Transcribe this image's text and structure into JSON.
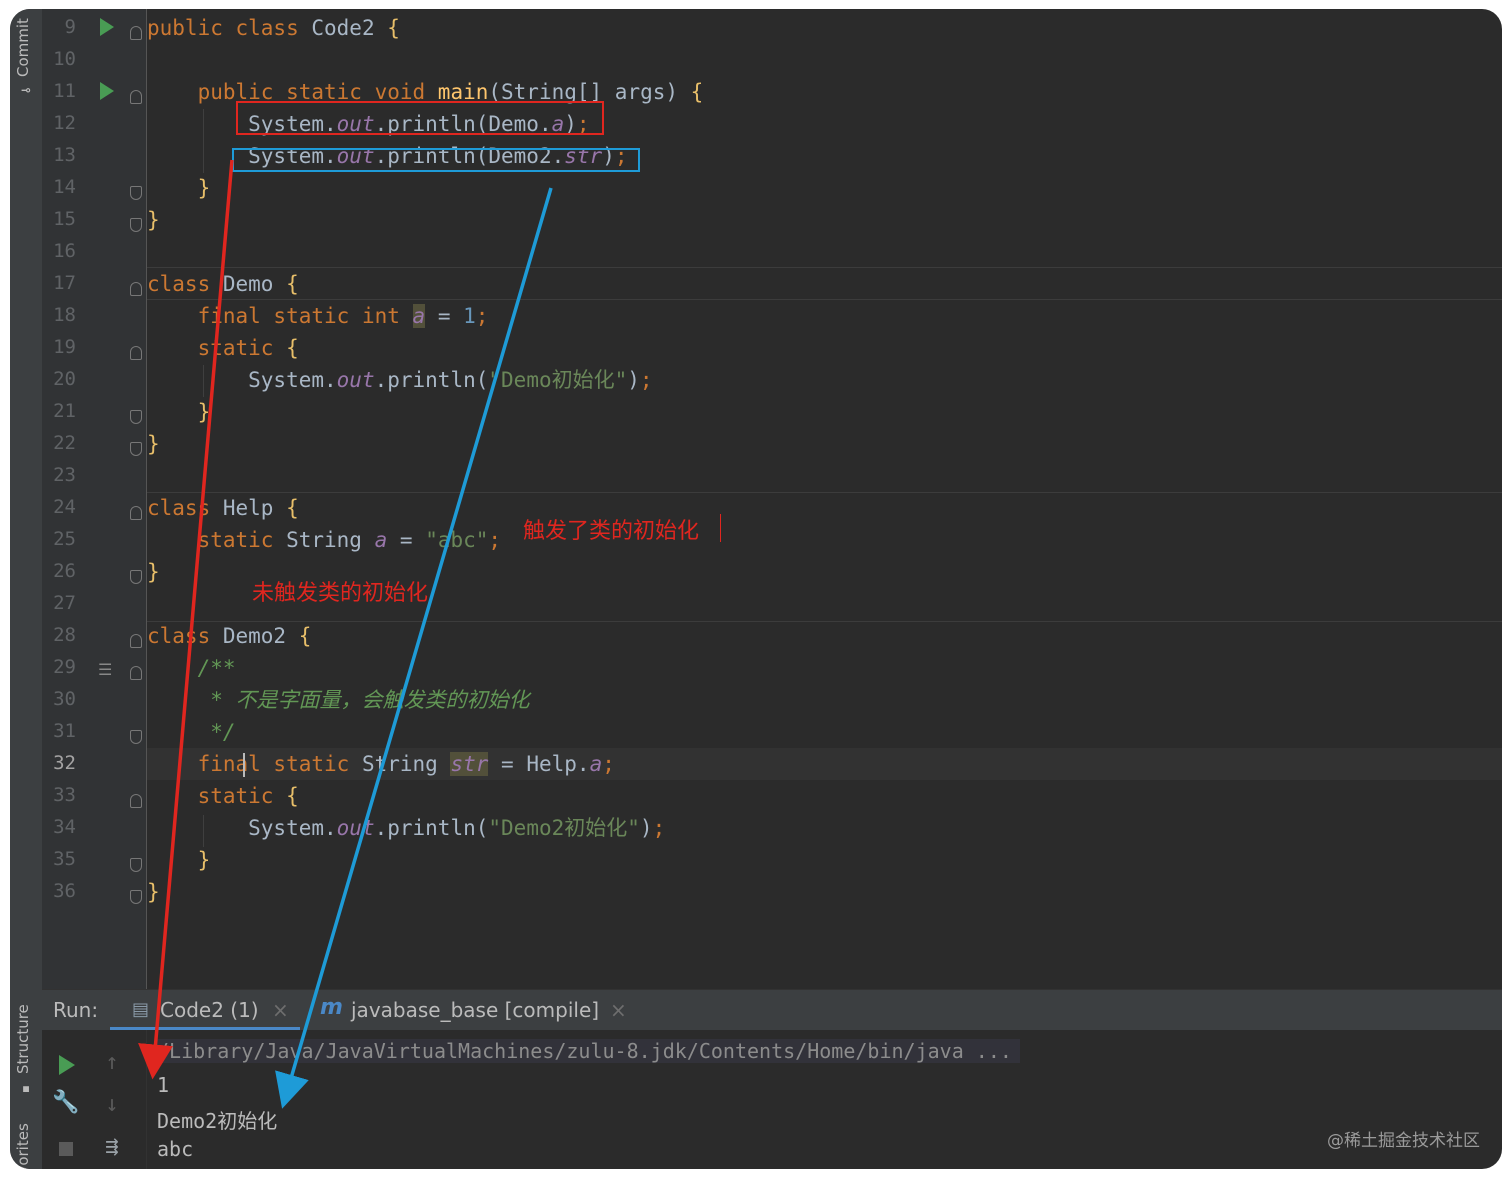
{
  "sidebar": {
    "commit_label": "Commit",
    "structure_label": "Structure",
    "favorites_label": "Favorites"
  },
  "code_lines": [
    {
      "num": "9",
      "text": "public class Code2 {"
    },
    {
      "num": "10",
      "text": ""
    },
    {
      "num": "11",
      "text": "    public static void main(String[] args) {"
    },
    {
      "num": "12",
      "text": "        System.out.println(Demo.a);"
    },
    {
      "num": "13",
      "text": "        System.out.println(Demo2.str);"
    },
    {
      "num": "14",
      "text": "    }"
    },
    {
      "num": "15",
      "text": "}"
    },
    {
      "num": "16",
      "text": ""
    },
    {
      "num": "17",
      "text": "class Demo {"
    },
    {
      "num": "18",
      "text": "    final static int a = 1;"
    },
    {
      "num": "19",
      "text": "    static {"
    },
    {
      "num": "20",
      "text": "        System.out.println(\"Demo初始化\");"
    },
    {
      "num": "21",
      "text": "    }"
    },
    {
      "num": "22",
      "text": "}"
    },
    {
      "num": "23",
      "text": ""
    },
    {
      "num": "24",
      "text": "class Help {"
    },
    {
      "num": "25",
      "text": "    static String a = \"abc\";"
    },
    {
      "num": "26",
      "text": "}"
    },
    {
      "num": "27",
      "text": ""
    },
    {
      "num": "28",
      "text": "class Demo2 {"
    },
    {
      "num": "29",
      "text": "    /**"
    },
    {
      "num": "30",
      "text": "     * 不是字面量，会触发类的初始化"
    },
    {
      "num": "31",
      "text": "     */"
    },
    {
      "num": "32",
      "text": "    final static String str = Help.a;"
    },
    {
      "num": "33",
      "text": "    static {"
    },
    {
      "num": "34",
      "text": "        System.out.println(\"Demo2初始化\");"
    },
    {
      "num": "35",
      "text": "    }"
    },
    {
      "num": "36",
      "text": "}"
    }
  ],
  "annotations": {
    "triggered": "触发了类的初始化",
    "not_triggered": "未触发类的初始化"
  },
  "run_panel": {
    "label": "Run:",
    "tab1": "Code2 (1)",
    "tab2_icon": "m",
    "tab2": "javabase_base [compile]",
    "close": "×",
    "command": "/Library/Java/JavaVirtualMachines/zulu-8.jdk/Contents/Home/bin/java ...",
    "output": [
      "1",
      "Demo2初始化",
      "abc"
    ]
  },
  "watermark": "@稀土掘金技术社区",
  "colors": {
    "red_annotation": "#e0261f",
    "blue_annotation": "#1e9bd7"
  }
}
